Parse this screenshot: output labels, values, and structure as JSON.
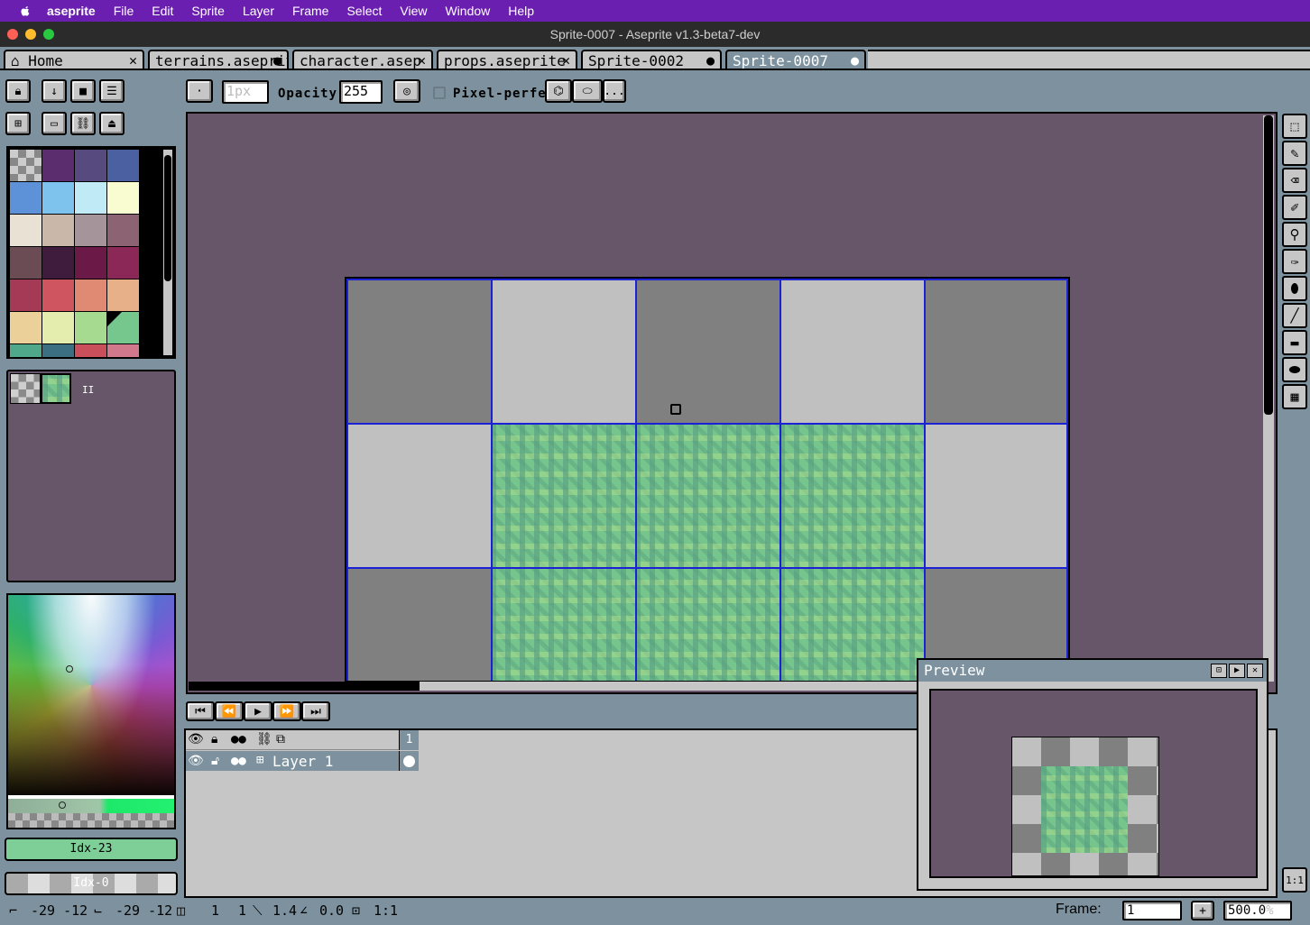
{
  "menubar": {
    "app": "aseprite",
    "items": [
      "File",
      "Edit",
      "Sprite",
      "Layer",
      "Frame",
      "Select",
      "View",
      "Window",
      "Help"
    ]
  },
  "window": {
    "title": "Sprite-0007 - Aseprite v1.3-beta7-dev"
  },
  "tabs": [
    {
      "label": "Home",
      "icon": "home-icon",
      "state": "close"
    },
    {
      "label": "terrains.aseprit",
      "state": "modified"
    },
    {
      "label": "character.asep",
      "state": "close"
    },
    {
      "label": "props.aseprite",
      "state": "close"
    },
    {
      "label": "Sprite-0002",
      "state": "modified"
    },
    {
      "label": "Sprite-0007",
      "state": "modified",
      "active": true
    }
  ],
  "toolbar": {
    "brush_size_placeholder": "1px",
    "opacity_label": "Opacity:",
    "opacity_value": "255",
    "pixel_perfect_label": "Pixel-perfect",
    "pixel_perfect_checked": false,
    "more_label": "..."
  },
  "palette": {
    "colors": [
      "transparent",
      "#5b2d6e",
      "#564a7e",
      "#4b60a1",
      "#5d92d8",
      "#7dc3ee",
      "#bfeaf6",
      "#f8fcd0",
      "#e9e1d4",
      "#c9b7aa",
      "#a5959a",
      "#8c6373",
      "#6b4c55",
      "#3f1b3e",
      "#6b1a48",
      "#8c2858",
      "#a53a56",
      "#cf5660",
      "#e08a74",
      "#e8b089",
      "#ecd09a",
      "#e4edae",
      "#a6da90",
      "#75c78e"
    ]
  },
  "tileset": {
    "separator_glyph": "II"
  },
  "colors": {
    "fg_label": "Idx-23",
    "bg_label": "Idx-0",
    "fg_hex": "#7ecf97",
    "editor_bg": "#67556a",
    "grid_line": "#1b22d6"
  },
  "timeline": {
    "frame_header": "1",
    "layer_name": "Layer 1"
  },
  "preview": {
    "title": "Preview"
  },
  "statusbar": {
    "pos_a": "-29  -12",
    "pos_b": "-29  -12",
    "size_w": "1",
    "size_h": "1",
    "dist": "1.4",
    "angle": "0.0",
    "ratio": "1:1",
    "frame_label": "Frame:",
    "frame_value": "1",
    "zoom_value": "500.0",
    "zoom_unit": "%",
    "one_to_one": "1:1"
  }
}
